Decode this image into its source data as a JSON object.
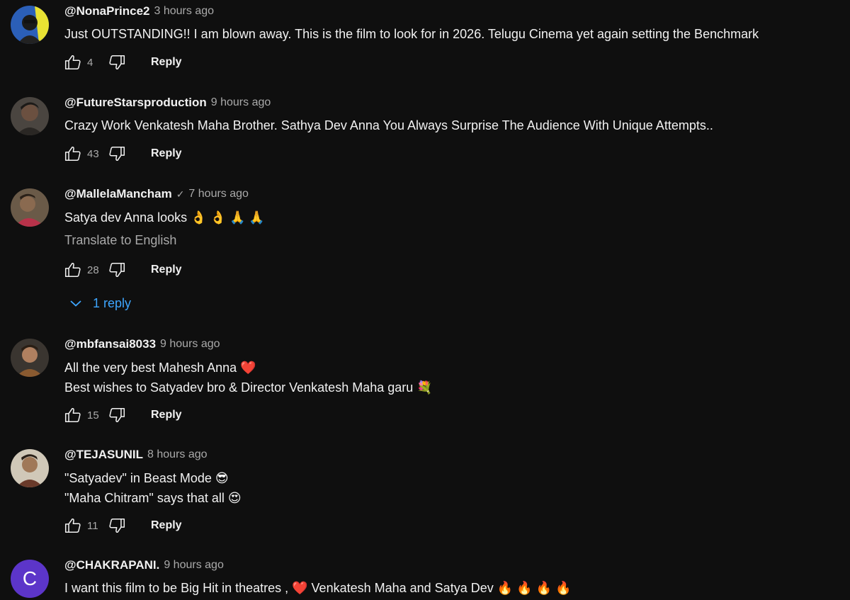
{
  "comments": [
    {
      "author": "@NonaPrince2",
      "time": "3 hours ago",
      "lines": [
        "Just OUTSTANDING!! I am blown away. This is the film to look for in 2026. Telugu Cinema yet again setting the Benchmark"
      ],
      "likes": "4",
      "reply_label": "Reply"
    },
    {
      "author": "@FutureStarsproduction",
      "time": "9 hours ago",
      "lines": [
        "Crazy Work Venkatesh Maha Brother. Sathya Dev Anna You Always Surprise The Audience With Unique Attempts.."
      ],
      "likes": "43",
      "reply_label": "Reply"
    },
    {
      "author": "@MallelaMancham",
      "verified": "✓",
      "time": "7 hours ago",
      "lines": [
        "Satya dev Anna looks 👌 👌 🙏 🙏"
      ],
      "translate": "Translate to English",
      "likes": "28",
      "reply_label": "Reply",
      "replies_label": "1 reply"
    },
    {
      "author": "@mbfansai8033",
      "time": "9 hours ago",
      "lines": [
        "All the very best Mahesh Anna ❤️",
        "Best wishes to Satyadev bro & Director Venkatesh Maha garu 💐"
      ],
      "likes": "15",
      "reply_label": "Reply"
    },
    {
      "author": "@TEJASUNIL",
      "time": "8 hours ago",
      "lines": [
        "\"Satyadev\" in Beast Mode 😎",
        "\"Maha Chitram\" says that all 😍"
      ],
      "likes": "11",
      "reply_label": "Reply"
    },
    {
      "author": "@CHAKRAPANI.",
      "time": "9 hours ago",
      "avatar_letter": "C",
      "lines": [
        "I want this film to be Big Hit in theatres , ❤️ Venkatesh Maha and Satya Dev 🔥 🔥 🔥 🔥"
      ]
    }
  ],
  "colors": {
    "background": "#0f0f0f",
    "text": "#f1f1f1",
    "secondary": "#aaaaaa",
    "link": "#3ea6ff",
    "letter_avatar": "#5c35c9"
  },
  "icons": [
    "like-icon",
    "dislike-icon",
    "chevron-down-icon",
    "verified-check-icon"
  ]
}
